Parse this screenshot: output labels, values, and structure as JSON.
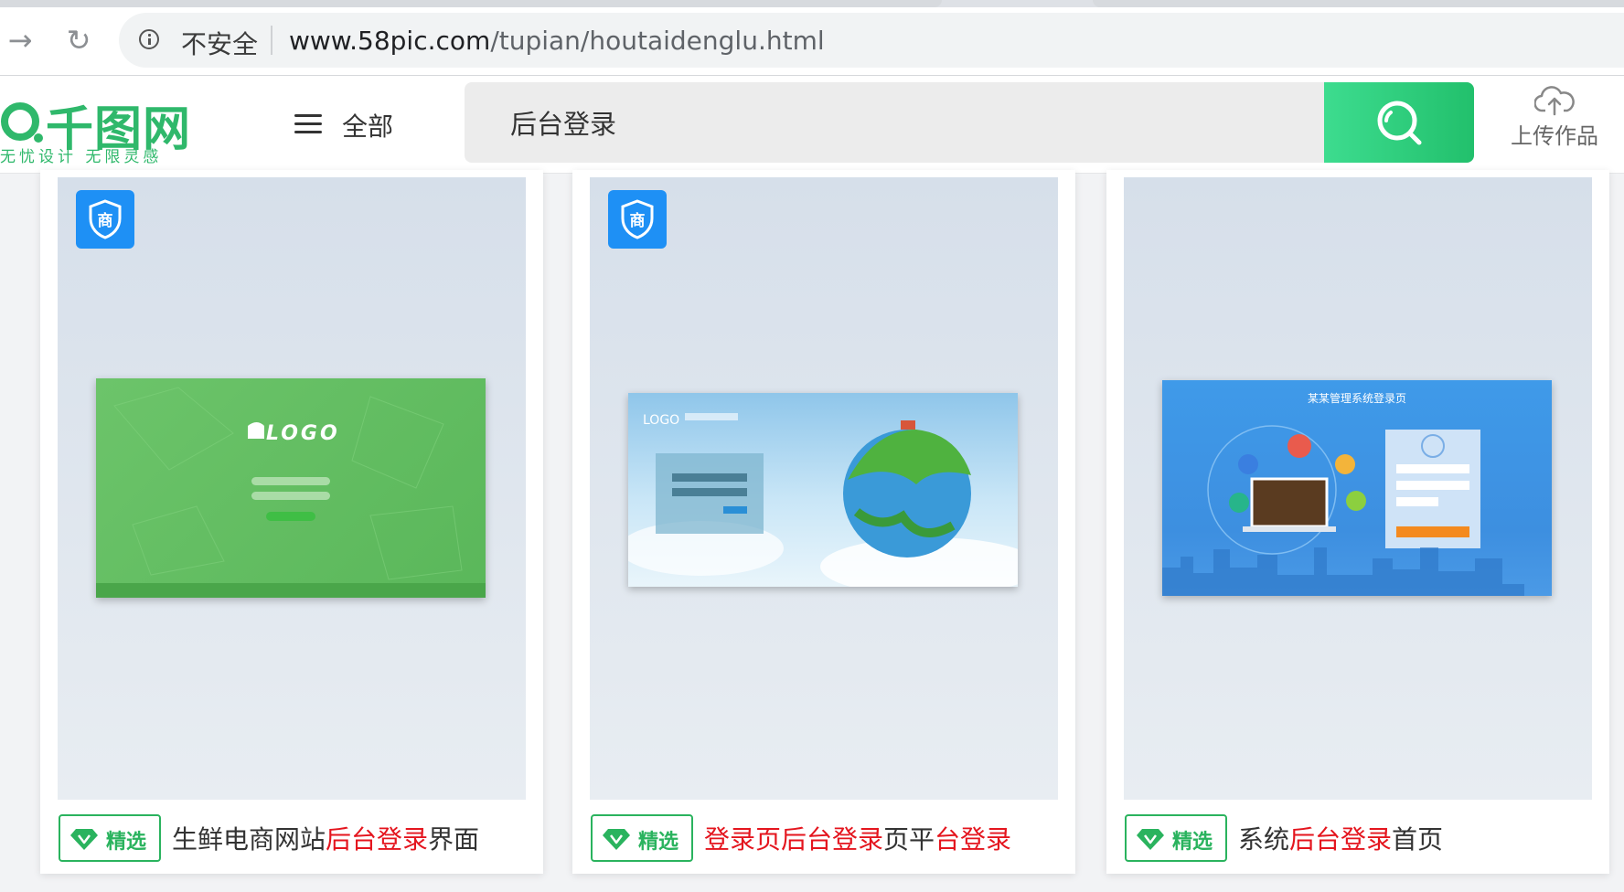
{
  "browser": {
    "security_label": "不安全",
    "url_host": "www.58pic.com",
    "url_path": "/tupian/houtaidenglu.html"
  },
  "site": {
    "logo_name": "千图网",
    "logo_slogan": "无忧设计 无限灵感",
    "menu_label": "全部",
    "search_value": "后台登录",
    "upload_label": "上传作品",
    "accent_color": "#22c06c"
  },
  "cards": [
    {
      "tag": "精选",
      "title_parts": [
        "生鲜电商网站",
        "后台登录",
        "界面"
      ],
      "has_shang_badge": true,
      "thumb_logo_text": "LOGO"
    },
    {
      "tag": "精选",
      "title_parts": [
        "登录页",
        "后台登录",
        "页平",
        "台登录"
      ],
      "has_shang_badge": true,
      "thumb_logo_text": "LOGO"
    },
    {
      "tag": "精选",
      "title_parts": [
        "系统",
        "后台登录",
        "首页"
      ],
      "has_shang_badge": false,
      "thumb_title_text": "某某管理系统登录页"
    }
  ],
  "badge_text": "商",
  "colors": {
    "highlight": "#e4151e",
    "tag_green": "#2ab35e",
    "shang_blue": "#1e90f5"
  }
}
